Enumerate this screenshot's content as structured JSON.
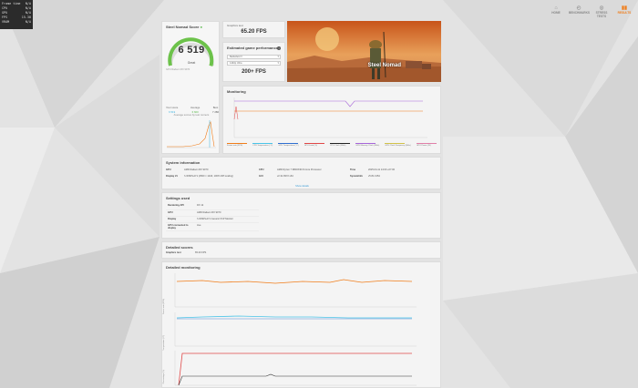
{
  "overlay_stats": [
    {
      "label": "Frame time",
      "value": "N/A"
    },
    {
      "label": "CPU",
      "value": "N/A"
    },
    {
      "label": "GPU",
      "value": "N/A"
    },
    {
      "label": "FPS",
      "value": "15.38"
    },
    {
      "label": "VRAM",
      "value": "N/A"
    }
  ],
  "nav": [
    {
      "label": "HOME",
      "icon": "home-icon",
      "glyph": "⌂"
    },
    {
      "label": "BENCHMARKS",
      "icon": "benchmarks-icon",
      "glyph": "◴"
    },
    {
      "label": "STRESS TESTS",
      "icon": "stress-icon",
      "glyph": "◎"
    },
    {
      "label": "RESULTS",
      "icon": "results-icon",
      "glyph": "▮▮"
    }
  ],
  "score": {
    "title": "Steel Nomad Score",
    "value": "6 519",
    "subtitle": "Great",
    "meta": "GPU Radeon RX 9070",
    "gauge_fraction": 0.82,
    "stats": [
      {
        "label": "Your score",
        "value": "6 519"
      },
      {
        "label": "Average",
        "value": "6 600"
      },
      {
        "label": "Best",
        "value": "7 280"
      }
    ],
    "chart_caption": "Average scores by test runners",
    "compare_link": "COMPARE RESULT ONLINE",
    "button": "SAVE RESULT"
  },
  "graphics_test": {
    "label": "Graphics test",
    "value": "65.20 FPS"
  },
  "estimated": {
    "title": "Estimated game performance",
    "game": "Battlefield V",
    "resolution": "1440p Ultra",
    "value": "200+ FPS"
  },
  "hero": {
    "title": "Steel Nomad"
  },
  "monitoring": {
    "title": "Monitoring",
    "legend": [
      {
        "label": "Frame rate (FPS)",
        "color": "#f07d1a"
      },
      {
        "label": "CPU Temperature (°C)",
        "color": "#4ac4e8"
      },
      {
        "label": "GPU Temperature (°C)",
        "color": "#2f6fd0"
      },
      {
        "label": "GPU Load (%)",
        "color": "#e04848"
      },
      {
        "label": "CPU Clock (MHz)",
        "color": "#222222"
      },
      {
        "label": "GPU Memory Clock (MHz)",
        "color": "#a766d9"
      },
      {
        "label": "GPU Clock Frequency (MHz)",
        "color": "#d2c24a"
      },
      {
        "label": "GPU Power (W)",
        "color": "#e07fa8"
      }
    ]
  },
  "system_info": {
    "title": "System information",
    "rows": [
      {
        "key": "GPU",
        "value": "AMD Radeon RX 9070"
      },
      {
        "key": "Display #1",
        "value": "\\\\.\\DISPLAY1 (2560 × 1440, 100% DPI scaling)"
      },
      {
        "key": "CPU",
        "value": "AMD Ryzen 7 9800X3D 8-Core Processor"
      },
      {
        "key": "GUI",
        "value": "v2.31.8372 s64"
      },
      {
        "key": "Time",
        "value": "2025-04-11 14:00 +07:00"
      },
      {
        "key": "SystemInfo",
        "value": "v5.81.1354"
      }
    ],
    "show_details": "Show details"
  },
  "settings": {
    "title": "Settings used",
    "rows": [
      {
        "key": "Rendering API",
        "value": "DX 12"
      },
      {
        "key": "GPU",
        "value": "AMD Radeon RX 9070"
      },
      {
        "key": "Display",
        "value": "\\\\.\\DISPLAY1 Generic PnP Monitor"
      },
      {
        "key": "GPU connected to display",
        "value": "true"
      }
    ]
  },
  "detailed_scores": {
    "title": "Detailed scores",
    "rows": [
      {
        "key": "Graphics test",
        "value": "65.20 FPS"
      }
    ]
  },
  "detailed_monitoring": {
    "title": "Detailed monitoring",
    "axis_fps": "Frame rate (FPS)",
    "axis_temp": "Temperature (°C)",
    "axis_pct": "Percentage (%)"
  }
}
